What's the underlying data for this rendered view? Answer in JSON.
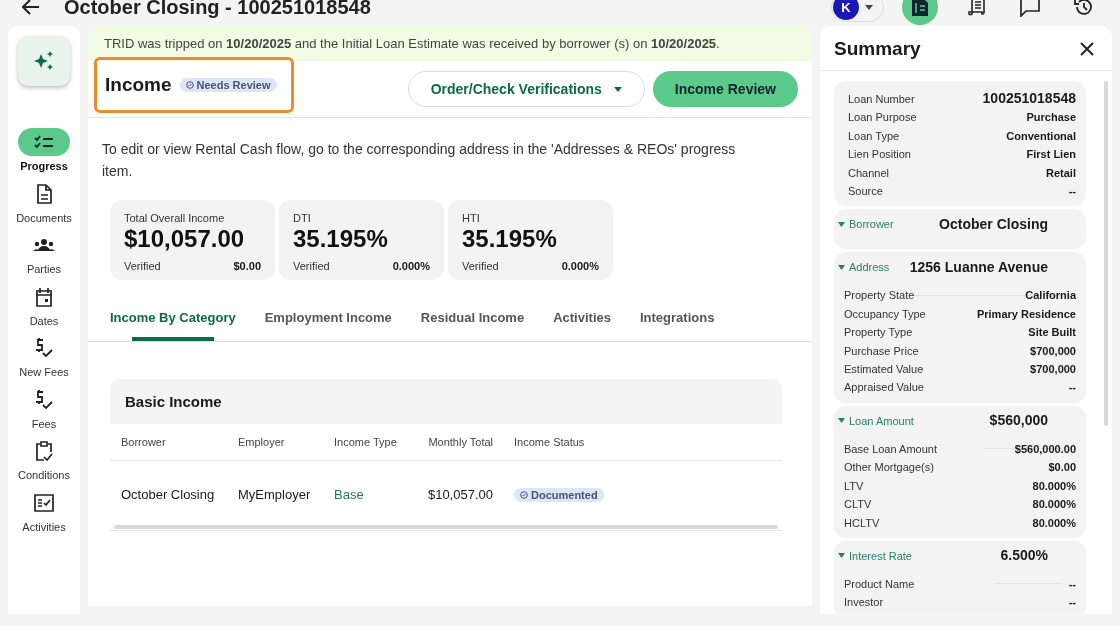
{
  "header": {
    "title": "October Closing - 100251018548",
    "avatar": "K"
  },
  "sidebar": {
    "items": [
      {
        "label": "Progress",
        "selected": true
      },
      {
        "label": "Documents",
        "selected": false
      },
      {
        "label": "Parties",
        "selected": false
      },
      {
        "label": "Dates",
        "selected": false
      },
      {
        "label": "New Fees",
        "selected": false
      },
      {
        "label": "Fees",
        "selected": false
      },
      {
        "label": "Conditions",
        "selected": false
      },
      {
        "label": "Activities",
        "selected": false
      }
    ]
  },
  "banner": {
    "text": "TRID was tripped on **10/20/2025** and the Initial Loan Estimate was received by borrower (s) on **10/20/2025**."
  },
  "section": {
    "title": "Income",
    "status": "Needs Review",
    "highlighted": true
  },
  "buttons": [
    {
      "label": "Order/Check Verifications",
      "kind": "dropdown"
    },
    {
      "label": "Income Review",
      "kind": "primary"
    }
  ],
  "note": "To edit or view Rental Cash flow, go to the corresponding address in the 'Addresses & REOs' progress item.",
  "stats": [
    {
      "label": "Total Overall Income",
      "value": "$10,057.00",
      "sub_label": "Verified",
      "sub_value": "$0.00"
    },
    {
      "label": "DTI",
      "value": "35.195%",
      "sub_label": "Verified",
      "sub_value": "0.000%"
    },
    {
      "label": "HTI",
      "value": "35.195%",
      "sub_label": "Verified",
      "sub_value": "0.000%"
    }
  ],
  "tabs": [
    {
      "label": "Income By Category",
      "selected": true
    },
    {
      "label": "Employment Income",
      "selected": false
    },
    {
      "label": "Residual Income",
      "selected": false
    },
    {
      "label": "Activities",
      "selected": false
    },
    {
      "label": "Integrations",
      "selected": false
    }
  ],
  "table": {
    "title": "Basic Income",
    "columns": [
      "Borrower",
      "Employer",
      "Income Type",
      "Monthly Total",
      "Income Status"
    ],
    "rows": [
      {
        "borrower": "October Closing",
        "employer": "MyEmployer",
        "income_type": "Base",
        "monthly_total": "$10,057.00",
        "income_status": "Documented"
      }
    ]
  },
  "summary": {
    "title": "Summary",
    "loan": [
      {
        "label": "Loan Number",
        "value": "100251018548"
      },
      {
        "label": "Loan Purpose",
        "value": "Purchase"
      },
      {
        "label": "Loan Type",
        "value": "Conventional"
      },
      {
        "label": "Lien Position",
        "value": "First Lien"
      },
      {
        "label": "Channel",
        "value": "Retail"
      },
      {
        "label": "Source",
        "value": "--"
      }
    ],
    "sections": [
      {
        "label": "Borrower",
        "value": "October Closing",
        "expanded": true
      },
      {
        "label": "Address",
        "value": "1256 Luanne Avenue",
        "expanded": true,
        "rows": [
          {
            "label": "Property State",
            "value": "California"
          },
          {
            "label": "Occupancy Type",
            "value": "Primary Residence"
          },
          {
            "label": "Property Type",
            "value": "Site Built"
          },
          {
            "label": "Purchase Price",
            "value": "$700,000"
          },
          {
            "label": "Estimated Value",
            "value": "$700,000"
          },
          {
            "label": "Appraised Value",
            "value": "--"
          }
        ]
      },
      {
        "label": "Loan Amount",
        "value": "$560,000",
        "expanded": true,
        "rows": [
          {
            "label": "Base Loan Amount",
            "value": "$560,000.00"
          },
          {
            "label": "Other Mortgage(s)",
            "value": "$0.00"
          },
          {
            "label": "LTV",
            "value": "80.000%"
          },
          {
            "label": "CLTV",
            "value": "80.000%"
          },
          {
            "label": "HCLTV",
            "value": "80.000%"
          }
        ]
      },
      {
        "label": "Interest Rate",
        "value": "6.500%",
        "expanded": true,
        "rows": [
          {
            "label": "Product Name",
            "value": "--"
          },
          {
            "label": "Investor",
            "value": "--"
          }
        ]
      }
    ]
  }
}
